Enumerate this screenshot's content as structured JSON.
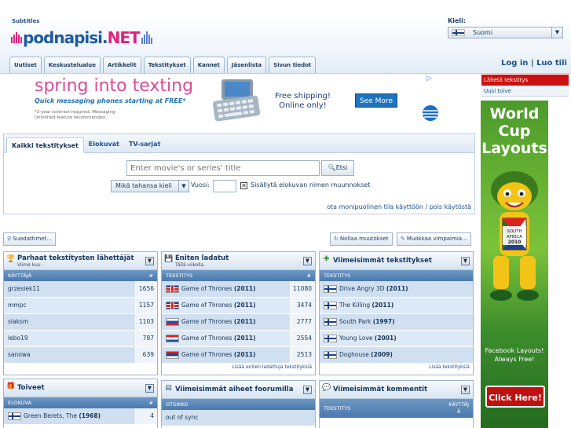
{
  "header": {
    "subtitles_label": "Subtitles",
    "logo_part1": "podnapisi.",
    "logo_part2": "NET",
    "nav_tabs": [
      "Uutiset",
      "Keskustelualue",
      "Artikkelit",
      "Tekstitykset",
      "Kannet",
      "Jäsenlista",
      "Sivun tiedot"
    ],
    "language_label": "Kieli:",
    "language_value": "Suomi",
    "login": "Log in",
    "separator": "|",
    "register": "Luo tili"
  },
  "ad": {
    "headline": "spring into texting",
    "tagline": "Quick messaging phones starting at FREE*",
    "fineprint_1": "*2-year contract required. Messaging",
    "fineprint_2": "Unlimited feature recommended.",
    "shipping_1": "Free shipping!",
    "shipping_2": "Online only!",
    "button": "See More"
  },
  "right_menu": {
    "send_subtitle": "Lähetä tekstitys",
    "new_wish": "Uusi toive"
  },
  "skyscraper": {
    "line1": "World",
    "line2": "Cup",
    "line3": "Layouts",
    "flag_text_1": "SOUTH",
    "flag_text_2": "AFRICA",
    "flag_text_3": "2010",
    "fb_1": "Facebook Layouts!",
    "fb_2": "Always Free!",
    "click": "Click Here!"
  },
  "search": {
    "tabs": [
      "Kaikki tekstitykset",
      "Elokuvat",
      "TV-sarjat"
    ],
    "placeholder": "Enter movie's or series' title",
    "button": "Etsi",
    "language_select": "Mikä tahansa kieli",
    "year_label": "Vuosi:",
    "checkbox_label": "Sisällytä elokuvan nimen muunnokset",
    "multiline_link": "ota monipuolinen tila käyttöön / pois käytöstä"
  },
  "toolbar": {
    "filters": "Suodattimet...",
    "reset": "Nollaa muutokset",
    "edit_widgets": "Muokkaa vimpaimia..."
  },
  "panels": {
    "top_uploaders": {
      "title": "Parhaat tekstitysten lähettäjät",
      "subtitle": "Viime kuu",
      "col1": "KÄYTTÄJÄ",
      "col2": "#",
      "rows": [
        {
          "name": "grzesiek11",
          "count": "1656"
        },
        {
          "name": "mmpc",
          "count": "1157"
        },
        {
          "name": "slaksm",
          "count": "1103"
        },
        {
          "name": "lebo19",
          "count": "787"
        },
        {
          "name": "sanowa",
          "count": "639"
        }
      ]
    },
    "most_downloaded": {
      "title": "Eniten ladatut",
      "subtitle": "Tällä viikolla",
      "col1": "TEKSTITYS",
      "col2": "#",
      "rows": [
        {
          "flag": "uk",
          "title": "Game of Thrones",
          "year": "(2011)",
          "count": "11080"
        },
        {
          "flag": "uk",
          "title": "Game of Thrones",
          "year": "(2011)",
          "count": "3474"
        },
        {
          "flag": "si",
          "title": "Game of Thrones",
          "year": "(2011)",
          "count": "2777"
        },
        {
          "flag": "hr",
          "title": "Game of Thrones",
          "year": "(2011)",
          "count": "2554"
        },
        {
          "flag": "rs",
          "title": "Game of Thrones",
          "year": "(2011)",
          "count": "2513"
        }
      ],
      "more": "Lisää eniten ladattuja tekstityksiä"
    },
    "latest_subtitles": {
      "title": "Viimeisimmät tekstitykset",
      "col1": "TEKSTITYS",
      "rows": [
        {
          "flag": "fi",
          "title": "Drive Angry 3D",
          "year": "(2011)"
        },
        {
          "flag": "fi",
          "title": "The Killing",
          "year": "(2011)"
        },
        {
          "flag": "fi",
          "title": "South Park",
          "year": "(1997)"
        },
        {
          "flag": "fi",
          "title": "Young Love",
          "year": "(2001)"
        },
        {
          "flag": "fi",
          "title": "Doghouse",
          "year": "(2009)"
        }
      ],
      "more": "Lisää tekstityksiä"
    },
    "wishes": {
      "title": "Toiveet",
      "col1": "ELOKUVA",
      "col2": "#",
      "rows": [
        {
          "flag": "fi",
          "title": "Green Berets, The",
          "year": "(1968)",
          "count": "4"
        }
      ]
    },
    "forum_topics": {
      "title": "Viimeisimmät aiheet foorumilla",
      "col1": "OTSIKKO",
      "rows": [
        {
          "title": "out of sync"
        }
      ]
    },
    "latest_comments": {
      "title": "Viimeisimmät kommentit",
      "col1": "TEKSTITYS",
      "col2_a": "KÄYTTÄJ",
      "col2_b": "Ä"
    }
  },
  "colors": {
    "accent": "#1d4f8c",
    "highlight": "#cc1111",
    "logo_pink": "#e2217e",
    "logo_blue": "#1e5aa0"
  }
}
